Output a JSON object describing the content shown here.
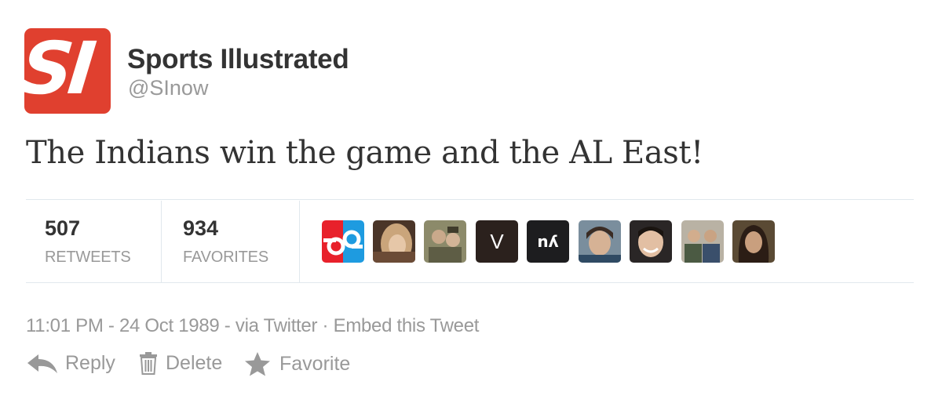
{
  "profile": {
    "name": "Sports Illustrated",
    "handle": "@SInow",
    "avatar_text": "SI",
    "avatar_color": "#e0402f"
  },
  "tweet": {
    "text": "The Indians win the game and the AL East!"
  },
  "stats": {
    "retweets_count": "507",
    "retweets_label": "RETWEETS",
    "favorites_count": "934",
    "favorites_label": "FAVORITES"
  },
  "favoriters": {
    "avatar_v_text": "V",
    "avatar_nv_text": "nʎ"
  },
  "meta": {
    "timestamp": "11:01 PM - 24 Oct 1989",
    "separator": " - ",
    "via": "via Twitter",
    "dot": " · ",
    "embed": "Embed this Tweet"
  },
  "actions": {
    "reply": "Reply",
    "delete": "Delete",
    "favorite": "Favorite"
  },
  "colors": {
    "text": "#333333",
    "muted": "#999999",
    "divider": "#e1e8ed"
  }
}
